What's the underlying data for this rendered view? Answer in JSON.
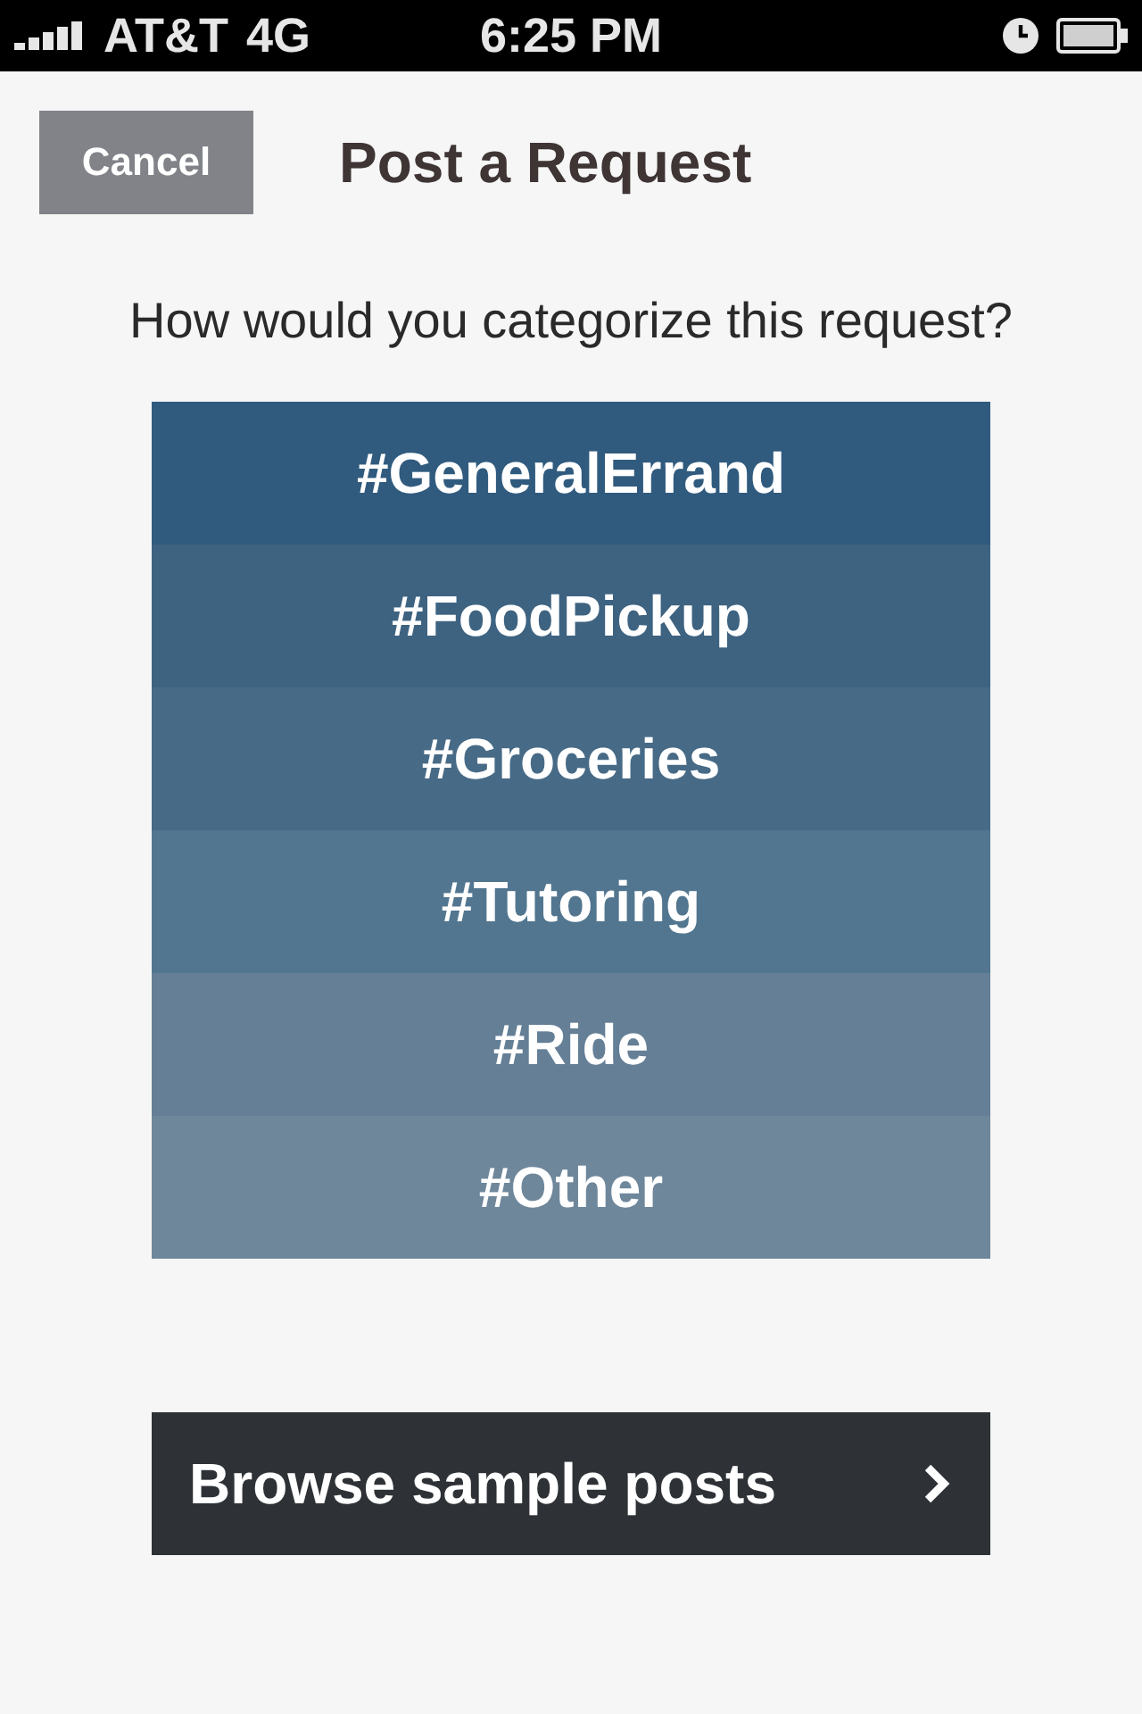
{
  "status_bar": {
    "carrier": "AT&T",
    "network": "4G",
    "time": "6:25 PM"
  },
  "header": {
    "cancel_button": "Cancel",
    "title": "Post a Request"
  },
  "prompt": "How would you categorize this request?",
  "categories": [
    {
      "label": "#GeneralErrand",
      "color": "#305b7e"
    },
    {
      "label": "#FoodPickup",
      "color": "#3e6381"
    },
    {
      "label": "#Groceries",
      "color": "#476a86"
    },
    {
      "label": "#Tutoring",
      "color": "#52768f"
    },
    {
      "label": "#Ride",
      "color": "#647f96"
    },
    {
      "label": "#Other",
      "color": "#6f879b"
    }
  ],
  "browse_button": {
    "label": "Browse sample posts"
  }
}
